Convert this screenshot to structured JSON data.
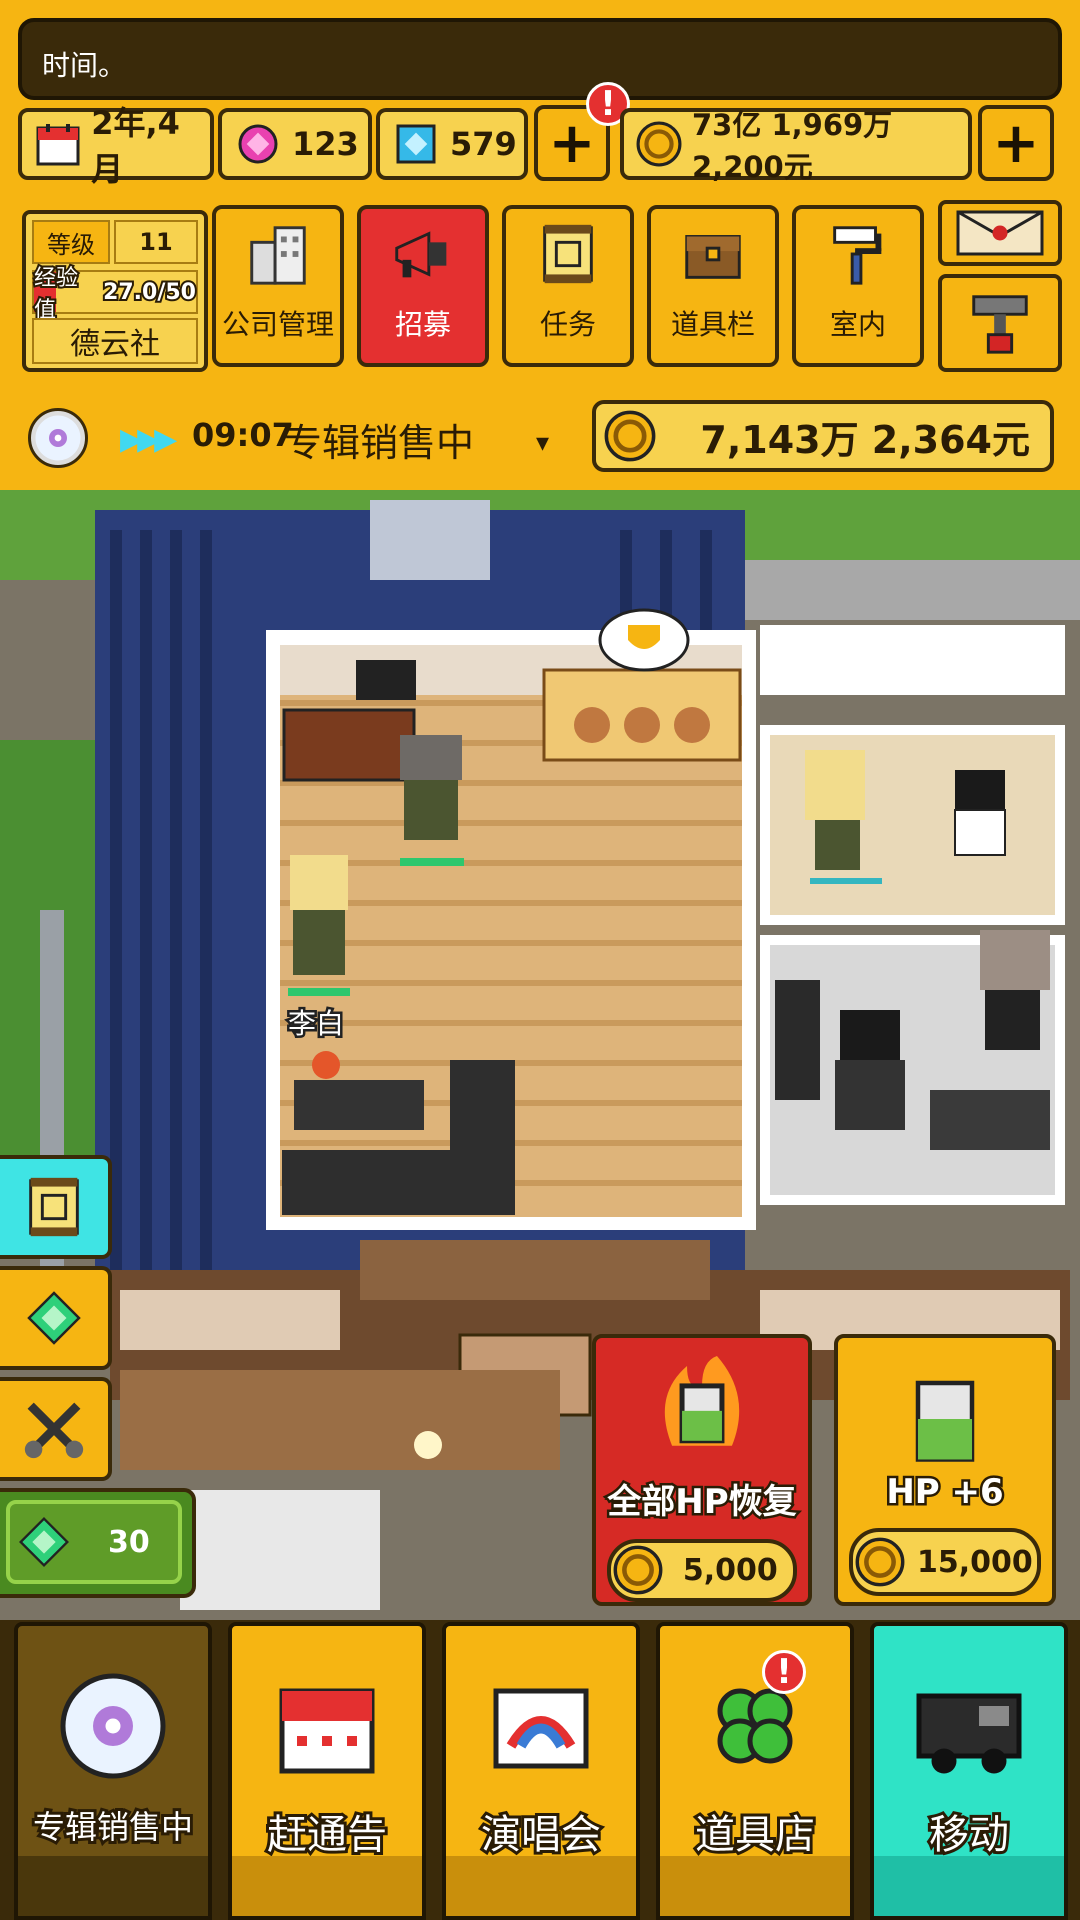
{
  "message": "时间。",
  "resources": {
    "date": "2年,4月",
    "gem_pink": "123",
    "gem_blue": "579",
    "money": "73亿 1,969万 2,200元",
    "alert_mark": "!"
  },
  "profile": {
    "level_label": "等级",
    "level_value": "11",
    "exp_label": "经验值",
    "exp_value": "27.0/50",
    "company_name": "德云社"
  },
  "actions": [
    {
      "label": "公司管理"
    },
    {
      "label": "招募"
    },
    {
      "label": "任务"
    },
    {
      "label": "道具栏"
    },
    {
      "label": "室内"
    }
  ],
  "status": {
    "timer": "09:07",
    "activity": "专辑销售中",
    "earnings": "7,143万 2,364元"
  },
  "scene": {
    "character_name": "李白"
  },
  "side": {
    "diamond_count": "30"
  },
  "hp_buttons": [
    {
      "label": "全部HP恢复",
      "cost": "5,000"
    },
    {
      "label": "HP +6",
      "cost": "15,000"
    }
  ],
  "nav": [
    {
      "label": "专辑销售中"
    },
    {
      "label": "赶通告"
    },
    {
      "label": "演唱会"
    },
    {
      "label": "道具店"
    },
    {
      "label": "移动"
    }
  ],
  "colors": {
    "gold": "#f6b512",
    "dark": "#3a2a0a",
    "red": "#e43030",
    "teal": "#2fe3c6"
  }
}
